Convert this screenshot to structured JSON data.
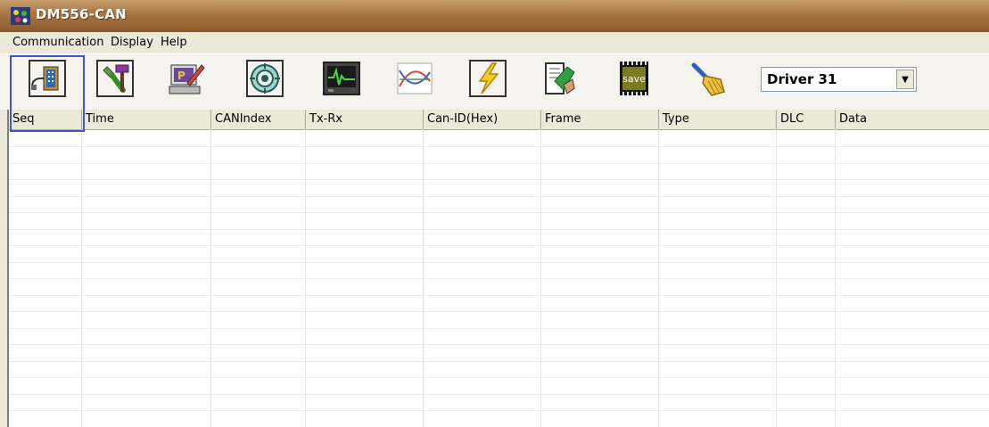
{
  "window": {
    "title": "DM556-CAN"
  },
  "menu": {
    "items": [
      "Communication",
      "Display",
      "Help"
    ]
  },
  "toolbar": {
    "buttons": [
      {
        "name": "connect",
        "icon": "serial-connector-icon"
      },
      {
        "name": "settings",
        "icon": "tools-wrench-icon"
      },
      {
        "name": "parameters",
        "icon": "computer-pen-icon"
      },
      {
        "name": "target",
        "icon": "target-dial-icon"
      },
      {
        "name": "monitor",
        "icon": "oscilloscope-icon"
      },
      {
        "name": "curves",
        "icon": "curve-graph-icon"
      },
      {
        "name": "power",
        "icon": "lightning-icon"
      },
      {
        "name": "file-transfer",
        "icon": "document-hand-icon"
      },
      {
        "name": "save",
        "icon": "save-chip-icon"
      },
      {
        "name": "clear",
        "icon": "broom-icon"
      }
    ],
    "save_icon_text": "save",
    "driver_select": {
      "value": "Driver 31"
    }
  },
  "table": {
    "columns": [
      "Seq",
      "Time",
      "CANIndex",
      "Tx-Rx",
      "Can-ID(Hex)",
      "Frame",
      "Type",
      "DLC",
      "Data"
    ],
    "rows": []
  },
  "colors": {
    "titlebar": "#a87845",
    "highlight": "#3c59c8",
    "window_bg": "#ece9d8"
  }
}
